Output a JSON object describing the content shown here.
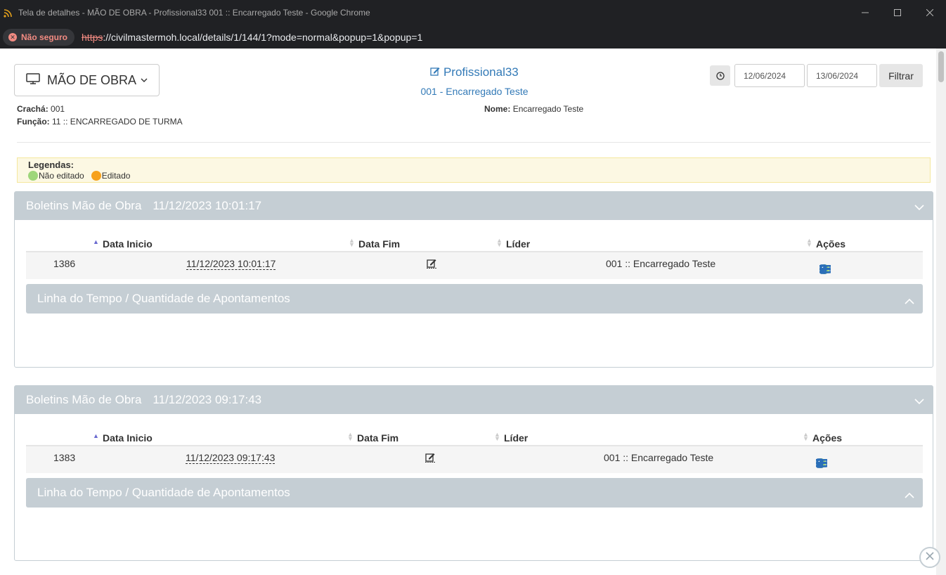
{
  "window": {
    "title": "Tela de detalhes - MÃO DE OBRA - Profissional33 001 :: Encarregado Teste - Google Chrome",
    "security_label": "Não seguro",
    "url_proto": "https",
    "url_rest": "://civilmastermoh.local/details/1/144/1?mode=normal&popup=1&popup=1"
  },
  "header": {
    "module_label": "MÃO DE OBRA",
    "profile_name": "Profissional33",
    "profile_sub": "001 - Encarregado Teste",
    "date_from": "12/06/2024",
    "date_to": "13/06/2024",
    "filter_label": "Filtrar"
  },
  "info": {
    "cracha_label": "Crachá:",
    "cracha_value": "001",
    "funcao_label": "Função:",
    "funcao_value": "11 :: ENCARREGADO DE TURMA",
    "nome_label": "Nome:",
    "nome_value": "Encarregado Teste"
  },
  "legend": {
    "title": "Legendas:",
    "items": [
      {
        "label": "Não editado",
        "color": "#9ed67a"
      },
      {
        "label": "Editado",
        "color": "#f7a11b"
      }
    ]
  },
  "columns": {
    "start": "Data Inicio",
    "end": "Data Fim",
    "leader": "Líder",
    "actions": "Ações"
  },
  "panels": [
    {
      "title": "Boletins Mão de Obra",
      "datetime": "11/12/2023 10:01:17",
      "row": {
        "id": "1386",
        "start": "11/12/2023 10:01:17",
        "leader": "001 :: Encarregado Teste"
      },
      "timeline_title": "Linha do Tempo / Quantidade de Apontamentos"
    },
    {
      "title": "Boletins Mão de Obra",
      "datetime": "11/12/2023 09:17:43",
      "row": {
        "id": "1383",
        "start": "11/12/2023 09:17:43",
        "leader": "001 :: Encarregado Teste"
      },
      "timeline_title": "Linha do Tempo / Quantidade de Apontamentos"
    }
  ],
  "colors": {
    "accent": "#337ab7",
    "panel_header": "#c5ced4",
    "action_icon": "#2a6eb8",
    "status_not_edited": "#9ed67a"
  }
}
